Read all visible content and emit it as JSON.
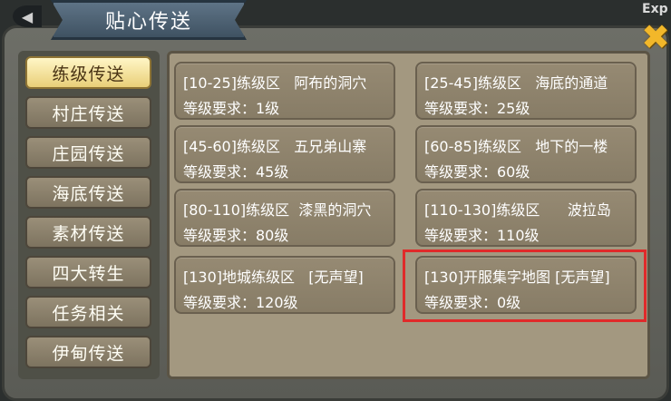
{
  "header": {
    "title": "贴心传送",
    "exp_label": "Exp",
    "back_glyph": "◀",
    "close_glyph": "✖"
  },
  "sidebar": {
    "items": [
      {
        "label": "练级传送",
        "active": true
      },
      {
        "label": "村庄传送",
        "active": false
      },
      {
        "label": "庄园传送",
        "active": false
      },
      {
        "label": "海底传送",
        "active": false
      },
      {
        "label": "素材传送",
        "active": false
      },
      {
        "label": "四大转生",
        "active": false
      },
      {
        "label": "任务相关",
        "active": false
      },
      {
        "label": "伊甸传送",
        "active": false
      }
    ]
  },
  "destinations": [
    {
      "name": "[10-25]练级区   阿布的洞穴",
      "requirement": "等级要求：1级"
    },
    {
      "name": "[25-45]练级区   海底的通道",
      "requirement": "等级要求：25级"
    },
    {
      "name": "[45-60]练级区   五兄弟山寨",
      "requirement": "等级要求：45级"
    },
    {
      "name": "[60-85]练级区   地下的一楼",
      "requirement": "等级要求：60级"
    },
    {
      "name": "[80-110]练级区  漆黑的洞穴",
      "requirement": "等级要求：80级"
    },
    {
      "name": "[110-130]练级区      波拉岛",
      "requirement": "等级要求：110级"
    },
    {
      "name": "[130]地城练级区   [无声望]",
      "requirement": "等级要求：120级"
    },
    {
      "name": "[130]开服集字地图 [无声望]",
      "requirement": "等级要求：0级"
    }
  ],
  "colors": {
    "highlight": "#e02a2a",
    "active_tab": "#e9cf78"
  }
}
